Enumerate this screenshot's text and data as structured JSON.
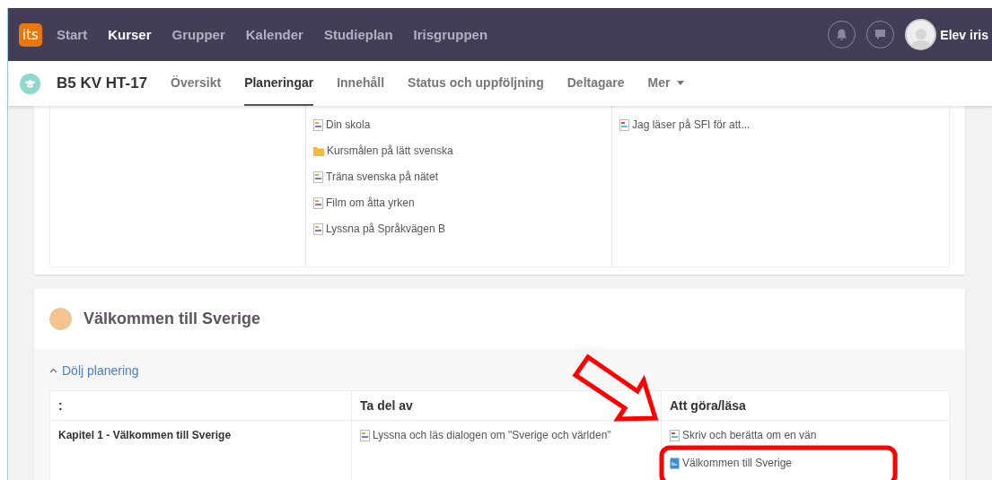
{
  "topnav": {
    "logo": "its",
    "items": [
      {
        "label": "Start",
        "selected": false
      },
      {
        "label": "Kurser",
        "selected": true
      },
      {
        "label": "Grupper",
        "selected": false
      },
      {
        "label": "Kalender",
        "selected": false
      },
      {
        "label": "Studieplan",
        "selected": false
      },
      {
        "label": "Irisgruppen",
        "selected": false
      }
    ],
    "user": "Elev iris"
  },
  "subnav": {
    "course": "B5 KV HT-17",
    "tabs": [
      {
        "label": "Översikt",
        "selected": false
      },
      {
        "label": "Planeringar",
        "selected": true
      },
      {
        "label": "Innehåll",
        "selected": false
      },
      {
        "label": "Status och uppföljning",
        "selected": false
      },
      {
        "label": "Deltagare",
        "selected": false
      },
      {
        "label": "Mer",
        "selected": false,
        "kind": "dropdown"
      }
    ]
  },
  "first_section": {
    "column_2": [
      {
        "text": "Din skola",
        "kind": "document"
      },
      {
        "text": "Kursmålen på lätt svenska",
        "kind": "folder"
      },
      {
        "text": "Träna svenska på nätet",
        "kind": "document"
      },
      {
        "text": "Film om åtta yrken",
        "kind": "document"
      },
      {
        "text": "Lyssna på Språkvägen B",
        "kind": "document"
      }
    ],
    "column_3": [
      {
        "text": "Jag läser på SFI för att...",
        "kind": "pdf"
      }
    ]
  },
  "second_section": {
    "title": "Välkommen till Sverige",
    "toggle": "Dölj planering",
    "expanded": true,
    "columns": [
      ":",
      "Ta del av",
      "Att göra/läsa"
    ],
    "rows": [
      {
        "title": "Kapitel 1 - Välkommen till Sverige",
        "ta_del_av": [
          {
            "text": "Lyssna och läs dialogen om \"Sverige och världen\"",
            "kind": "document"
          }
        ],
        "att_gora": [
          {
            "text": "Skriv och berätta om en vän",
            "kind": "pdf"
          },
          {
            "text": "Välkommen till Sverige",
            "kind": "word"
          }
        ]
      }
    ]
  }
}
